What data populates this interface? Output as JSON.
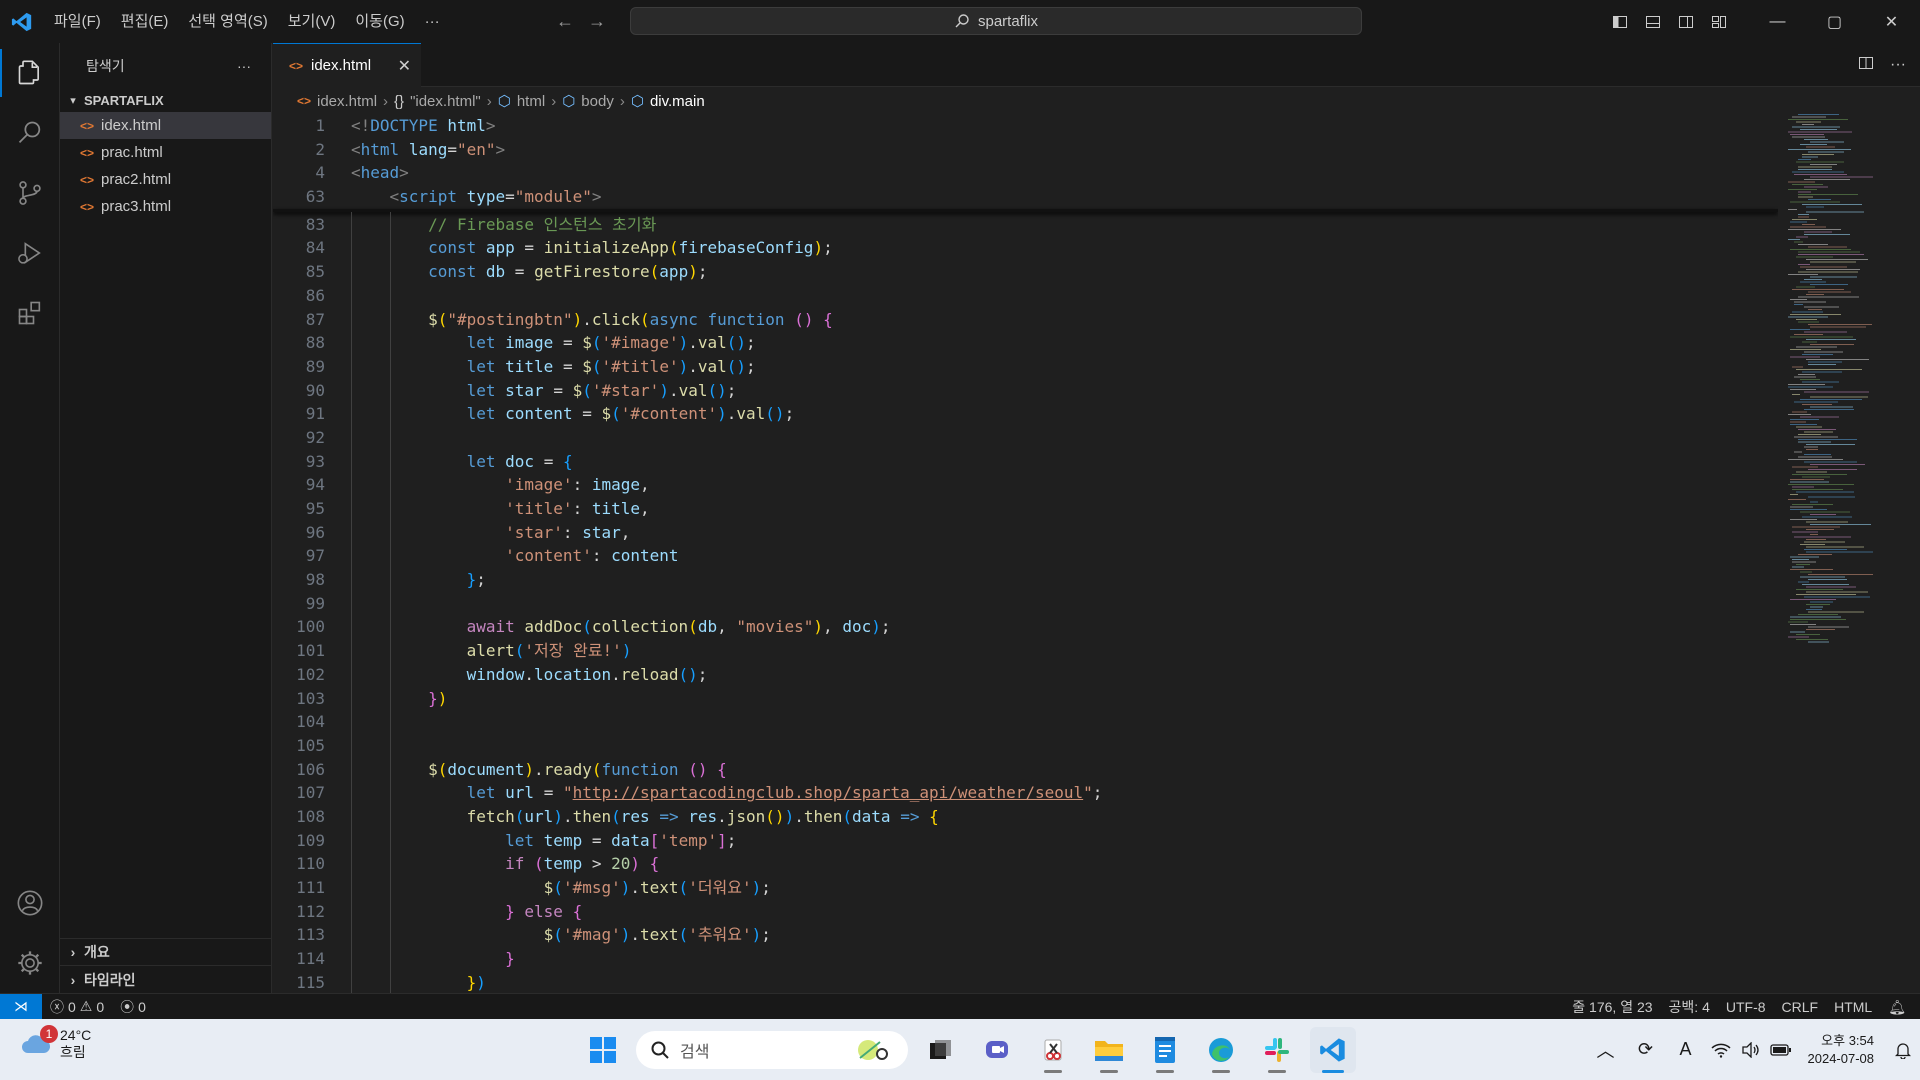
{
  "titlebar": {
    "menu": [
      "파일(F)",
      "편집(E)",
      "선택 영역(S)",
      "보기(V)",
      "이동(G)",
      "···"
    ],
    "search": "spartaflix"
  },
  "sidebar": {
    "title": "탐색기",
    "more": "···",
    "project": "SPARTAFLIX",
    "files": [
      "idex.html",
      "prac.html",
      "prac2.html",
      "prac3.html"
    ],
    "bottom_sections": [
      "개요",
      "타임라인"
    ]
  },
  "tab": {
    "label": "idex.html"
  },
  "breadcrumb": [
    "idex.html",
    "\"idex.html\"",
    "html",
    "body",
    "div.main"
  ],
  "code_lines": [
    {
      "n": "1",
      "h": "<span class='t-gray'>&lt;!</span><span class='t-tag'>DOCTYPE</span> <span class='t-attr'>html</span><span class='t-gray'>&gt;</span>"
    },
    {
      "n": "2",
      "h": "<span class='t-gray'>&lt;</span><span class='t-tag'>html</span> <span class='t-attr'>lang</span><span class='t-txt'>=</span><span class='t-str'>\"en\"</span><span class='t-gray'>&gt;</span>"
    },
    {
      "n": "4",
      "h": "<span class='t-gray'>&lt;</span><span class='t-tag'>head</span><span class='t-gray'>&gt;</span>"
    },
    {
      "n": "63",
      "h": "    <span class='t-gray'>&lt;</span><span class='t-tag'>script</span> <span class='t-attr'>type</span><span class='t-txt'>=</span><span class='t-str'>\"module\"</span><span class='t-gray'>&gt;</span>"
    },
    {
      "n": "83",
      "h": "        <span class='t-cmt'>// Firebase 인스턴스 초기화</span>"
    },
    {
      "n": "84",
      "h": "        <span class='t-kw'>const</span> <span class='t-var'>app</span> <span class='t-txt'>=</span> <span class='t-fn'>initializeApp</span><span class='t-br1'>(</span><span class='t-var'>firebaseConfig</span><span class='t-br1'>)</span><span class='t-txt'>;</span>"
    },
    {
      "n": "85",
      "h": "        <span class='t-kw'>const</span> <span class='t-var'>db</span> <span class='t-txt'>=</span> <span class='t-fn'>getFirestore</span><span class='t-br1'>(</span><span class='t-var'>app</span><span class='t-br1'>)</span><span class='t-txt'>;</span>"
    },
    {
      "n": "86",
      "h": ""
    },
    {
      "n": "87",
      "h": "        <span class='t-fn'>$</span><span class='t-br1'>(</span><span class='t-str'>\"#postingbtn\"</span><span class='t-br1'>)</span><span class='t-txt'>.</span><span class='t-fn'>click</span><span class='t-br1'>(</span><span class='t-kw'>async</span> <span class='t-kw'>function</span> <span class='t-br2'>()</span> <span class='t-br2'>{</span>"
    },
    {
      "n": "88",
      "h": "            <span class='t-kw'>let</span> <span class='t-var'>image</span> <span class='t-txt'>=</span> <span class='t-fn'>$</span><span class='t-br3'>(</span><span class='t-str'>'#image'</span><span class='t-br3'>)</span><span class='t-txt'>.</span><span class='t-fn'>val</span><span class='t-br3'>()</span><span class='t-txt'>;</span>"
    },
    {
      "n": "89",
      "h": "            <span class='t-kw'>let</span> <span class='t-var'>title</span> <span class='t-txt'>=</span> <span class='t-fn'>$</span><span class='t-br3'>(</span><span class='t-str'>'#title'</span><span class='t-br3'>)</span><span class='t-txt'>.</span><span class='t-fn'>val</span><span class='t-br3'>()</span><span class='t-txt'>;</span>"
    },
    {
      "n": "90",
      "h": "            <span class='t-kw'>let</span> <span class='t-var'>star</span> <span class='t-txt'>=</span> <span class='t-fn'>$</span><span class='t-br3'>(</span><span class='t-str'>'#star'</span><span class='t-br3'>)</span><span class='t-txt'>.</span><span class='t-fn'>val</span><span class='t-br3'>()</span><span class='t-txt'>;</span>"
    },
    {
      "n": "91",
      "h": "            <span class='t-kw'>let</span> <span class='t-var'>content</span> <span class='t-txt'>=</span> <span class='t-fn'>$</span><span class='t-br3'>(</span><span class='t-str'>'#content'</span><span class='t-br3'>)</span><span class='t-txt'>.</span><span class='t-fn'>val</span><span class='t-br3'>()</span><span class='t-txt'>;</span>"
    },
    {
      "n": "92",
      "h": ""
    },
    {
      "n": "93",
      "h": "            <span class='t-kw'>let</span> <span class='t-var'>doc</span> <span class='t-txt'>=</span> <span class='t-br3'>{</span>"
    },
    {
      "n": "94",
      "h": "                <span class='t-str'>'image'</span><span class='t-txt'>: </span><span class='t-var'>image</span><span class='t-txt'>,</span>"
    },
    {
      "n": "95",
      "h": "                <span class='t-str'>'title'</span><span class='t-txt'>: </span><span class='t-var'>title</span><span class='t-txt'>,</span>"
    },
    {
      "n": "96",
      "h": "                <span class='t-str'>'star'</span><span class='t-txt'>: </span><span class='t-var'>star</span><span class='t-txt'>,</span>"
    },
    {
      "n": "97",
      "h": "                <span class='t-str'>'content'</span><span class='t-txt'>: </span><span class='t-var'>content</span>"
    },
    {
      "n": "98",
      "h": "            <span class='t-br3'>}</span><span class='t-txt'>;</span>"
    },
    {
      "n": "99",
      "h": ""
    },
    {
      "n": "100",
      "h": "            <span class='t-ctl'>await</span> <span class='t-fn'>addDoc</span><span class='t-br3'>(</span><span class='t-fn'>collection</span><span class='t-br1'>(</span><span class='t-var'>db</span><span class='t-txt'>, </span><span class='t-str'>\"movies\"</span><span class='t-br1'>)</span><span class='t-txt'>, </span><span class='t-var'>doc</span><span class='t-br3'>)</span><span class='t-txt'>;</span>"
    },
    {
      "n": "101",
      "h": "            <span class='t-fn'>alert</span><span class='t-br3'>(</span><span class='t-str'>'저장 완료!'</span><span class='t-br3'>)</span>"
    },
    {
      "n": "102",
      "h": "            <span class='t-var'>window</span><span class='t-txt'>.</span><span class='t-var'>location</span><span class='t-txt'>.</span><span class='t-fn'>reload</span><span class='t-br3'>()</span><span class='t-txt'>;</span>"
    },
    {
      "n": "103",
      "h": "        <span class='t-br2'>}</span><span class='t-br1'>)</span>"
    },
    {
      "n": "104",
      "h": ""
    },
    {
      "n": "105",
      "h": ""
    },
    {
      "n": "106",
      "h": "        <span class='t-fn'>$</span><span class='t-br1'>(</span><span class='t-var'>document</span><span class='t-br1'>)</span><span class='t-txt'>.</span><span class='t-fn'>ready</span><span class='t-br1'>(</span><span class='t-kw'>function</span> <span class='t-br2'>()</span> <span class='t-br2'>{</span>"
    },
    {
      "n": "107",
      "h": "            <span class='t-kw'>let</span> <span class='t-var'>url</span> <span class='t-txt'>=</span> <span class='t-str'>\"</span><span class='t-link'>http://spartacodingclub.shop/sparta_api/weather/seoul</span><span class='t-str'>\"</span><span class='t-txt'>;</span>"
    },
    {
      "n": "108",
      "h": "            <span class='t-fn'>fetch</span><span class='t-br3'>(</span><span class='t-var'>url</span><span class='t-br3'>)</span><span class='t-txt'>.</span><span class='t-fn'>then</span><span class='t-br3'>(</span><span class='t-var'>res</span> <span class='t-kw'>=&gt;</span> <span class='t-var'>res</span><span class='t-txt'>.</span><span class='t-fn'>json</span><span class='t-br1'>()</span><span class='t-br3'>)</span><span class='t-txt'>.</span><span class='t-fn'>then</span><span class='t-br3'>(</span><span class='t-var'>data</span> <span class='t-kw'>=&gt;</span> <span class='t-br1'>{</span>"
    },
    {
      "n": "109",
      "h": "                <span class='t-kw'>let</span> <span class='t-var'>temp</span> <span class='t-txt'>=</span> <span class='t-var'>data</span><span class='t-br2'>[</span><span class='t-str'>'temp'</span><span class='t-br2'>]</span><span class='t-txt'>;</span>"
    },
    {
      "n": "110",
      "h": "                <span class='t-ctl'>if</span> <span class='t-br2'>(</span><span class='t-var'>temp</span> <span class='t-txt'>&gt;</span> <span class='t-num'>20</span><span class='t-br2'>)</span> <span class='t-br2'>{</span>"
    },
    {
      "n": "111",
      "h": "                    <span class='t-fn'>$</span><span class='t-br3'>(</span><span class='t-str'>'#msg'</span><span class='t-br3'>)</span><span class='t-txt'>.</span><span class='t-fn'>text</span><span class='t-br3'>(</span><span class='t-str'>'더워요'</span><span class='t-br3'>)</span><span class='t-txt'>;</span>"
    },
    {
      "n": "112",
      "h": "                <span class='t-br2'>}</span> <span class='t-ctl'>else</span> <span class='t-br2'>{</span>"
    },
    {
      "n": "113",
      "h": "                    <span class='t-fn'>$</span><span class='t-br3'>(</span><span class='t-str'>'#mag'</span><span class='t-br3'>)</span><span class='t-txt'>.</span><span class='t-fn'>text</span><span class='t-br3'>(</span><span class='t-str'>'추워요'</span><span class='t-br3'>)</span><span class='t-txt'>;</span>"
    },
    {
      "n": "114",
      "h": "                <span class='t-br2'>}</span>"
    },
    {
      "n": "115",
      "h": "            <span class='t-br1'>}</span><span class='t-br3'>)</span>"
    }
  ],
  "statusbar": {
    "errors": "0",
    "warnings": "0",
    "ports": "0",
    "cursor": "줄 176, 열 23",
    "indent": "공백: 4",
    "encoding": "UTF-8",
    "eol": "CRLF",
    "language": "HTML"
  },
  "taskbar": {
    "temperature": "24°C",
    "condition": "흐림",
    "notifications": "1",
    "search_placeholder": "검색",
    "time": "오후 3:54",
    "date": "2024-07-08"
  },
  "colors": {
    "accent": "#0078d4",
    "editor_bg": "#1f1f1f",
    "sidebar_bg": "#181818"
  }
}
